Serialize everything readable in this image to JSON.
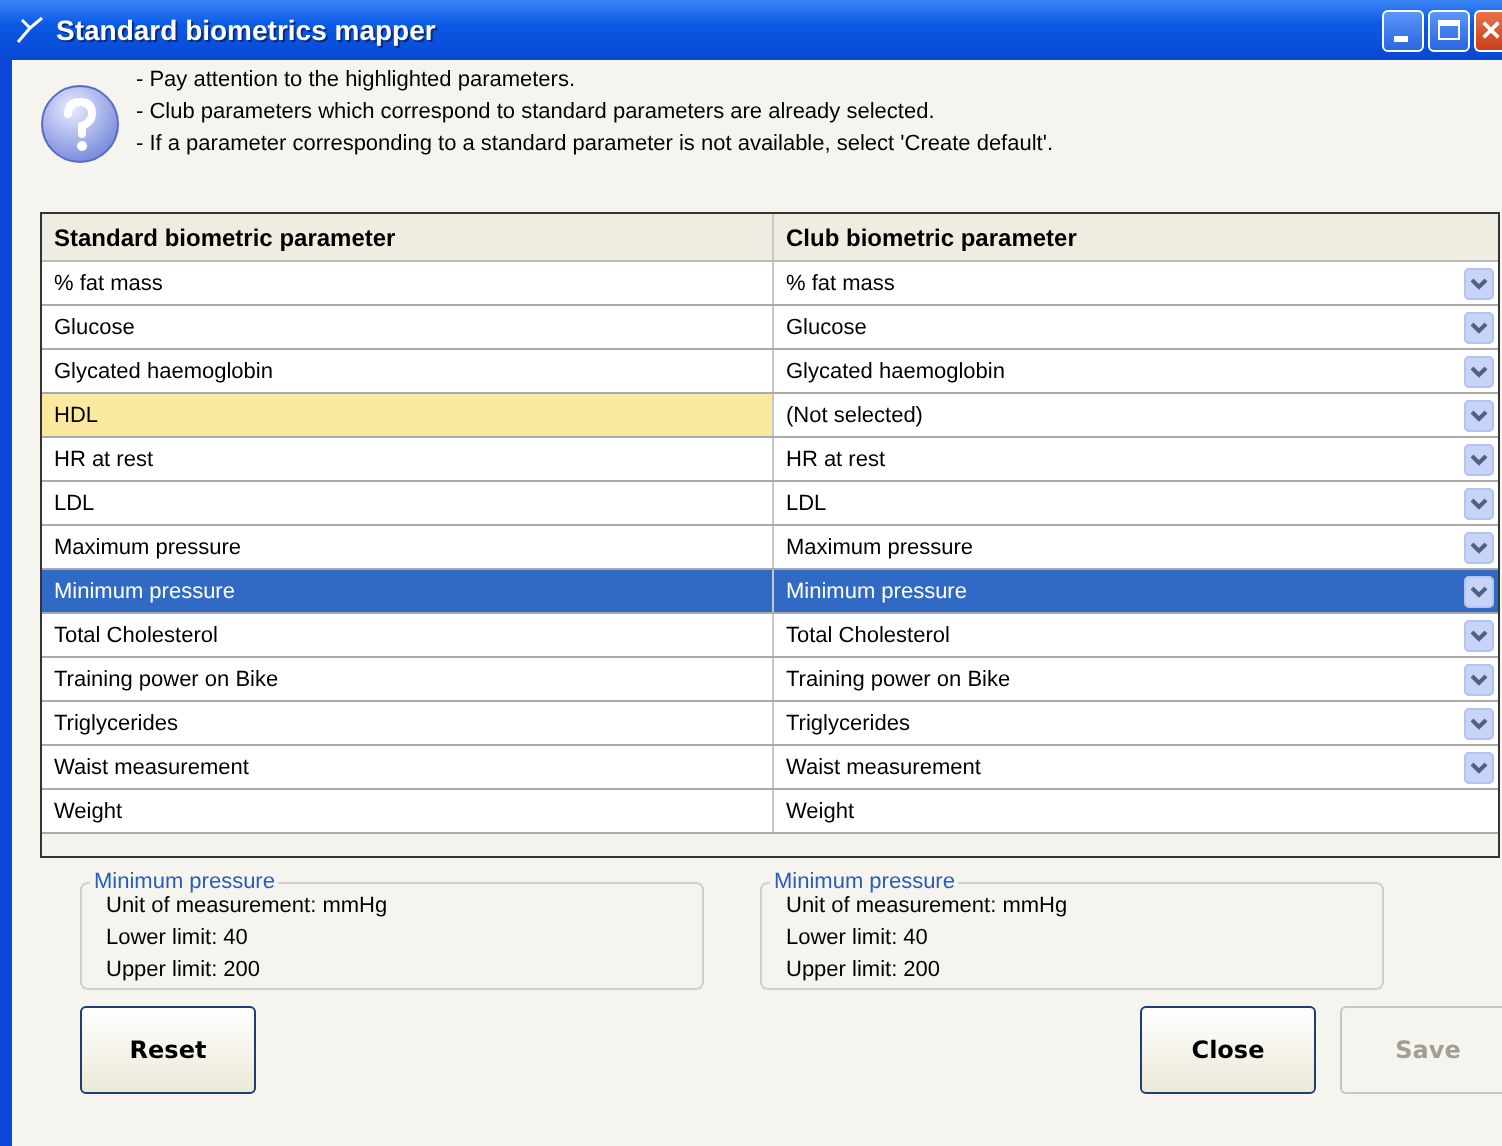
{
  "window": {
    "title": "Standard biometrics mapper"
  },
  "instructions": [
    "- Pay attention to the highlighted parameters.",
    "- Club parameters which correspond to standard parameters are already selected.",
    "- If a parameter corresponding to a standard parameter is not available, select 'Create default'."
  ],
  "table": {
    "columns": [
      "Standard biometric parameter",
      "Club biometric parameter"
    ],
    "rows": [
      {
        "standard": "% fat mass",
        "club": "% fat mass",
        "highlighted": false,
        "selected": false,
        "dropdown": true
      },
      {
        "standard": "Glucose",
        "club": "Glucose",
        "highlighted": false,
        "selected": false,
        "dropdown": true
      },
      {
        "standard": "Glycated haemoglobin",
        "club": "Glycated haemoglobin",
        "highlighted": false,
        "selected": false,
        "dropdown": true
      },
      {
        "standard": "HDL",
        "club": "(Not selected)",
        "highlighted": true,
        "selected": false,
        "dropdown": true
      },
      {
        "standard": "HR at rest",
        "club": "HR at rest",
        "highlighted": false,
        "selected": false,
        "dropdown": true
      },
      {
        "standard": "LDL",
        "club": "LDL",
        "highlighted": false,
        "selected": false,
        "dropdown": true
      },
      {
        "standard": "Maximum pressure",
        "club": "Maximum pressure",
        "highlighted": false,
        "selected": false,
        "dropdown": true
      },
      {
        "standard": "Minimum pressure",
        "club": "Minimum pressure",
        "highlighted": false,
        "selected": true,
        "dropdown": true
      },
      {
        "standard": "Total Cholesterol",
        "club": "Total Cholesterol",
        "highlighted": false,
        "selected": false,
        "dropdown": true
      },
      {
        "standard": "Training power on Bike",
        "club": "Training power on Bike",
        "highlighted": false,
        "selected": false,
        "dropdown": true
      },
      {
        "standard": "Triglycerides",
        "club": "Triglycerides",
        "highlighted": false,
        "selected": false,
        "dropdown": true
      },
      {
        "standard": "Waist measurement",
        "club": "Waist measurement",
        "highlighted": false,
        "selected": false,
        "dropdown": true
      },
      {
        "standard": "Weight",
        "club": "Weight",
        "highlighted": false,
        "selected": false,
        "dropdown": false
      }
    ]
  },
  "details": [
    {
      "title": "Minimum pressure",
      "lines": [
        "Unit of measurement: mmHg",
        "Lower limit: 40",
        "Upper limit: 200"
      ]
    },
    {
      "title": "Minimum pressure",
      "lines": [
        "Unit of measurement: mmHg",
        "Lower limit: 40",
        "Upper limit: 200"
      ]
    }
  ],
  "buttons_left": [
    {
      "label": "Reset",
      "disabled": false
    }
  ],
  "buttons_right": [
    {
      "label": "Close",
      "disabled": false
    },
    {
      "label": "Save",
      "disabled": true
    }
  ]
}
